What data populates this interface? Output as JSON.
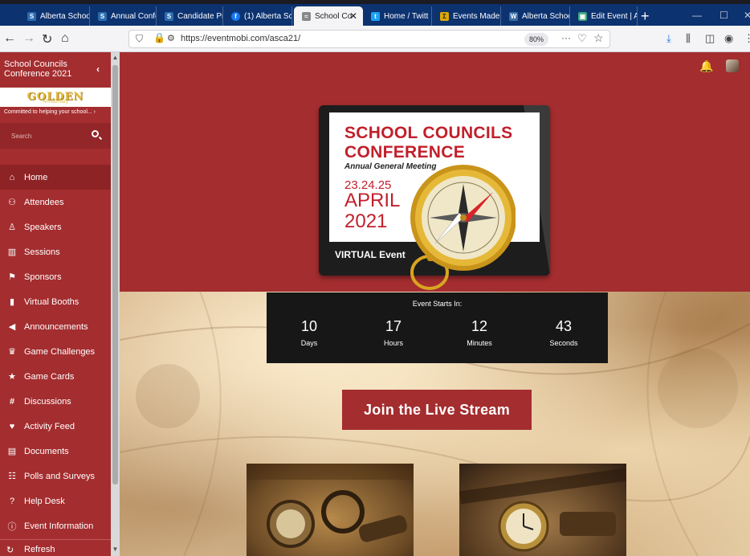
{
  "browser": {
    "tabs": [
      {
        "label": "Alberta Schoo",
        "color": "#2b6cb0",
        "glyph": "S"
      },
      {
        "label": "Annual Confe",
        "color": "#2b6cb0",
        "glyph": "S"
      },
      {
        "label": "Candidate Pr",
        "color": "#2b6cb0",
        "glyph": "S"
      },
      {
        "label": "(1) Alberta Sc",
        "color": "#1877f2",
        "glyph": "f"
      },
      {
        "label": "School Co",
        "color": "#888888",
        "glyph": "≈",
        "active": true
      },
      {
        "label": "Home / Twitt",
        "color": "#1da1f2",
        "glyph": "t"
      },
      {
        "label": "Events Made",
        "color": "#e0a800",
        "glyph": "Σ"
      },
      {
        "label": "Alberta Schoo",
        "color": "#3b6ea5",
        "glyph": "W"
      },
      {
        "label": "Edit Event | A",
        "color": "#3aa17e",
        "glyph": "▣"
      }
    ],
    "url": "https://eventmobi.com/asca21/",
    "zoom": "80%"
  },
  "sidebar": {
    "title": "School Councils Conference 2021",
    "banner_logo": "GOLDEN",
    "banner_logo_sub": "Anniversary",
    "banner_tagline": "Committed to helping your school... ›",
    "search_placeholder": "Search",
    "items": [
      {
        "label": "Home",
        "icon": "home-icon",
        "glyph": "⌂"
      },
      {
        "label": "Attendees",
        "icon": "attendees-icon",
        "glyph": "👥"
      },
      {
        "label": "Speakers",
        "icon": "speakers-icon",
        "glyph": "👤"
      },
      {
        "label": "Sessions",
        "icon": "sessions-icon",
        "glyph": "▥"
      },
      {
        "label": "Sponsors",
        "icon": "sponsors-icon",
        "glyph": "⚑"
      },
      {
        "label": "Virtual Booths",
        "icon": "bookmark-icon",
        "glyph": "▮"
      },
      {
        "label": "Announcements",
        "icon": "megaphone-icon",
        "glyph": "📢"
      },
      {
        "label": "Game Challenges",
        "icon": "trophy-icon",
        "glyph": "🏆"
      },
      {
        "label": "Game Cards",
        "icon": "star-icon",
        "glyph": "★"
      },
      {
        "label": "Discussions",
        "icon": "hashtag-icon",
        "glyph": "#"
      },
      {
        "label": "Activity Feed",
        "icon": "heart-icon",
        "glyph": "♥"
      },
      {
        "label": "Documents",
        "icon": "document-icon",
        "glyph": "🗎"
      },
      {
        "label": "Polls and Surveys",
        "icon": "poll-icon",
        "glyph": "▤"
      },
      {
        "label": "Help Desk",
        "icon": "help-icon",
        "glyph": "?"
      },
      {
        "label": "Event Information",
        "icon": "info-icon",
        "glyph": "i"
      }
    ],
    "bottom_label": "Refresh"
  },
  "poster": {
    "title_line1": "SCHOOL COUNCILS",
    "title_line2": "CONFERENCE",
    "subtitle": "Annual General Meeting",
    "date_days": "23.24.25",
    "date_month": "APRIL",
    "date_year": "2021",
    "virtual_label": "VIRTUAL Event"
  },
  "countdown": {
    "label": "Event Starts In:",
    "units": [
      {
        "value": "10",
        "label": "Days"
      },
      {
        "value": "17",
        "label": "Hours"
      },
      {
        "value": "12",
        "label": "Minutes"
      },
      {
        "value": "43",
        "label": "Seconds"
      }
    ]
  },
  "join_button": "Join the Live Stream",
  "colors": {
    "brand_red": "#a42d2f",
    "browser_chrome": "#0c3270"
  }
}
